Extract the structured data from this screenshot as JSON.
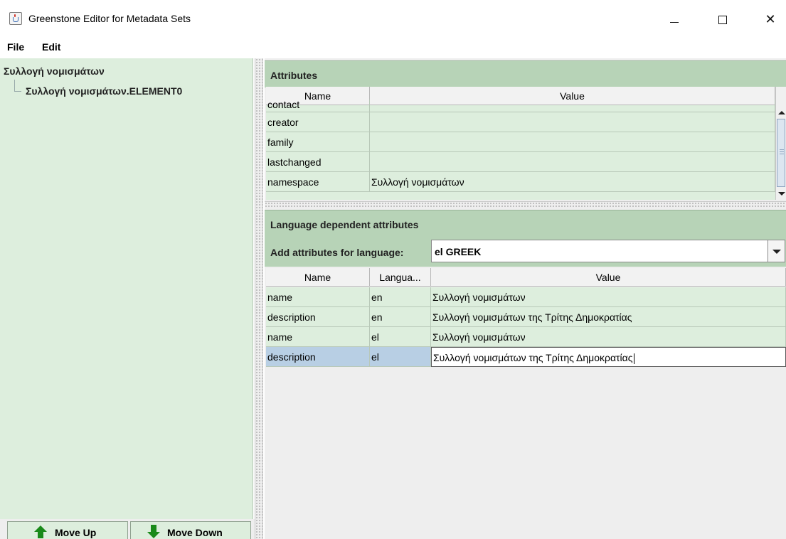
{
  "window": {
    "title": "Greenstone Editor for Metadata Sets",
    "controls": {
      "minimize": "—",
      "maximize": "☐",
      "close": "✕"
    }
  },
  "menu": {
    "file": "File",
    "edit": "Edit"
  },
  "tree": {
    "root": "Συλλογή νομισμάτων",
    "child": "Συλλογή νομισμάτων.ELEMENT0"
  },
  "buttons": {
    "move_up": "Move Up",
    "move_down": "Move Down"
  },
  "attributes": {
    "title": "Attributes",
    "columns": {
      "name": "Name",
      "value": "Value"
    },
    "rows": [
      {
        "name": "contact",
        "value": ""
      },
      {
        "name": "creator",
        "value": ""
      },
      {
        "name": "family",
        "value": ""
      },
      {
        "name": "lastchanged",
        "value": ""
      },
      {
        "name": "namespace",
        "value": "Συλλογή νομισμάτων"
      }
    ]
  },
  "language_attributes": {
    "title": "Language dependent attributes",
    "add_label": "Add attributes for language:",
    "selected_language": "el  GREEK",
    "columns": {
      "name": "Name",
      "language": "Langua...",
      "value": "Value"
    },
    "rows": [
      {
        "name": "name",
        "language": "en",
        "value": "Συλλογή νομισμάτων"
      },
      {
        "name": "description",
        "language": "en",
        "value": "Συλλογή νομισμάτων της Τρίτης Δημοκρατίας"
      },
      {
        "name": "name",
        "language": "el",
        "value": "Συλλογή νομισμάτων"
      },
      {
        "name": "description",
        "language": "el",
        "value": "Συλλογή νομισμάτων της Τρίτης Δημοκρατίας"
      }
    ]
  },
  "colors": {
    "panel_green": "#ddeedd",
    "header_green": "#b7d3b7",
    "selection_blue": "#b8cfe4",
    "arrow_green": "#1a8a1a"
  },
  "icons": [
    "java-app-icon",
    "arrow-up-icon",
    "arrow-down-icon",
    "scroll-up-icon",
    "scroll-down-icon",
    "dropdown-arrow-icon"
  ]
}
